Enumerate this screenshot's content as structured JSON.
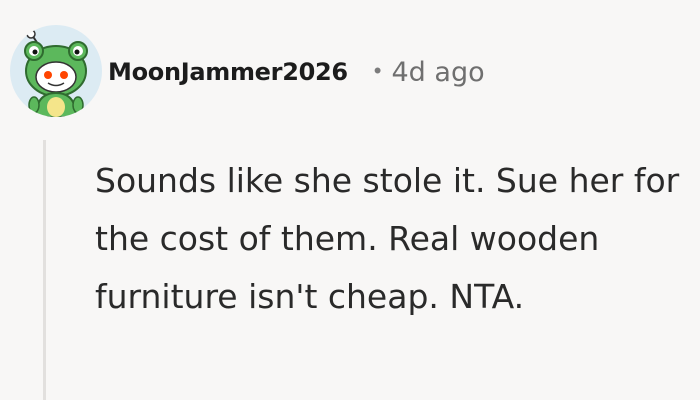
{
  "comment": {
    "username": "MoonJammer2026",
    "separator": "•",
    "timestamp": "4d ago",
    "avatar_icon": "snoo-frog-costume-avatar",
    "body": "Sounds like she stole it. Sue her for the cost of them. Real wooden furniture isn't cheap. NTA."
  },
  "colors": {
    "background": "#f8f7f6",
    "thread_line": "#e2e0de",
    "avatar_bg": "#dcebf3",
    "frog_green": "#5cb85c"
  }
}
